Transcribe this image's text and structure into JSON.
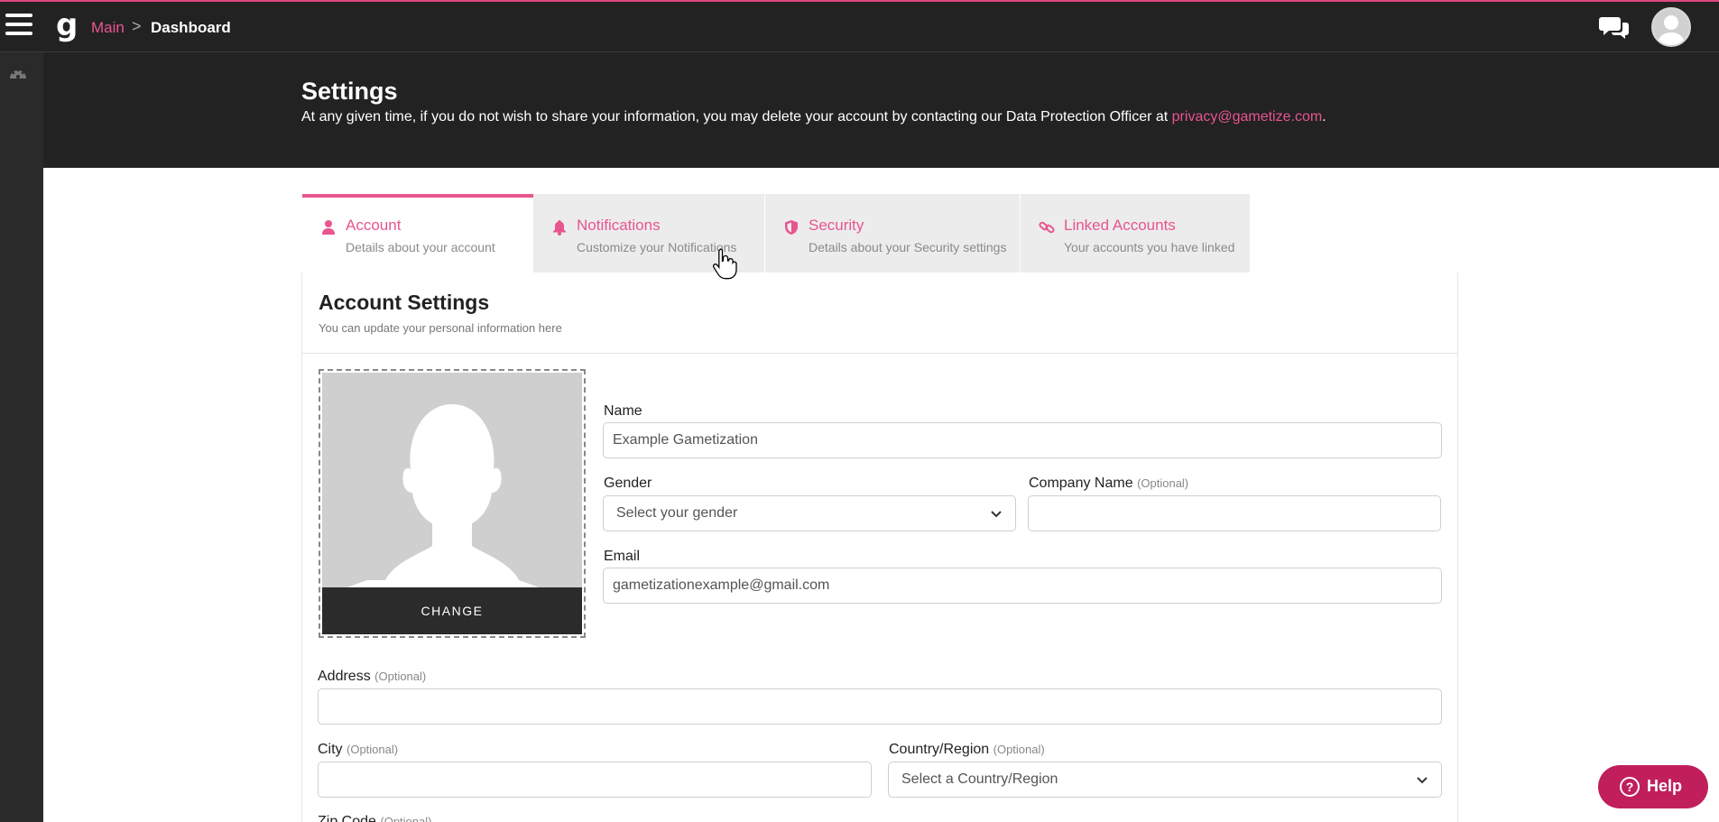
{
  "topbar": {
    "logo": "g",
    "breadcrumb": {
      "main": "Main",
      "separator": ">",
      "current": "Dashboard"
    }
  },
  "header": {
    "title": "Settings",
    "notice": "At any given time, if you do not wish to share your information, you may delete your account by contacting our Data Protection Officer at ",
    "email": "privacy@gametize.com",
    "notice_end": "."
  },
  "tabs": [
    {
      "title": "Account",
      "subtitle": "Details about your account",
      "icon": "user-icon",
      "active": true
    },
    {
      "title": "Notifications",
      "subtitle": "Customize your Notifications",
      "icon": "bell-icon",
      "active": false
    },
    {
      "title": "Security",
      "subtitle": "Details about your Security settings",
      "icon": "shield-icon",
      "active": false
    },
    {
      "title": "Linked Accounts",
      "subtitle": "Your accounts you have linked",
      "icon": "link-icon",
      "active": false
    }
  ],
  "account": {
    "title": "Account Settings",
    "subtitle": "You can update your personal information here",
    "photo_button": "CHANGE",
    "fields": {
      "name": {
        "label": "Name",
        "value": "Example Gametization"
      },
      "gender": {
        "label": "Gender",
        "value": "Select your gender"
      },
      "company": {
        "label": "Company Name",
        "optional": "(Optional)",
        "value": ""
      },
      "email": {
        "label": "Email",
        "value": "gametizationexample@gmail.com"
      },
      "address": {
        "label": "Address",
        "optional": "(Optional)",
        "value": ""
      },
      "city": {
        "label": "City",
        "optional": "(Optional)",
        "value": ""
      },
      "country": {
        "label": "Country/Region",
        "optional": "(Optional)",
        "value": "Select a Country/Region"
      },
      "zip": {
        "label": "Zip Code",
        "optional": "(Optional)"
      }
    }
  },
  "help": {
    "label": "Help",
    "icon_glyph": "?"
  },
  "colors": {
    "accent": "#e8558f",
    "dark": "#222222",
    "help": "#c01f5c"
  }
}
